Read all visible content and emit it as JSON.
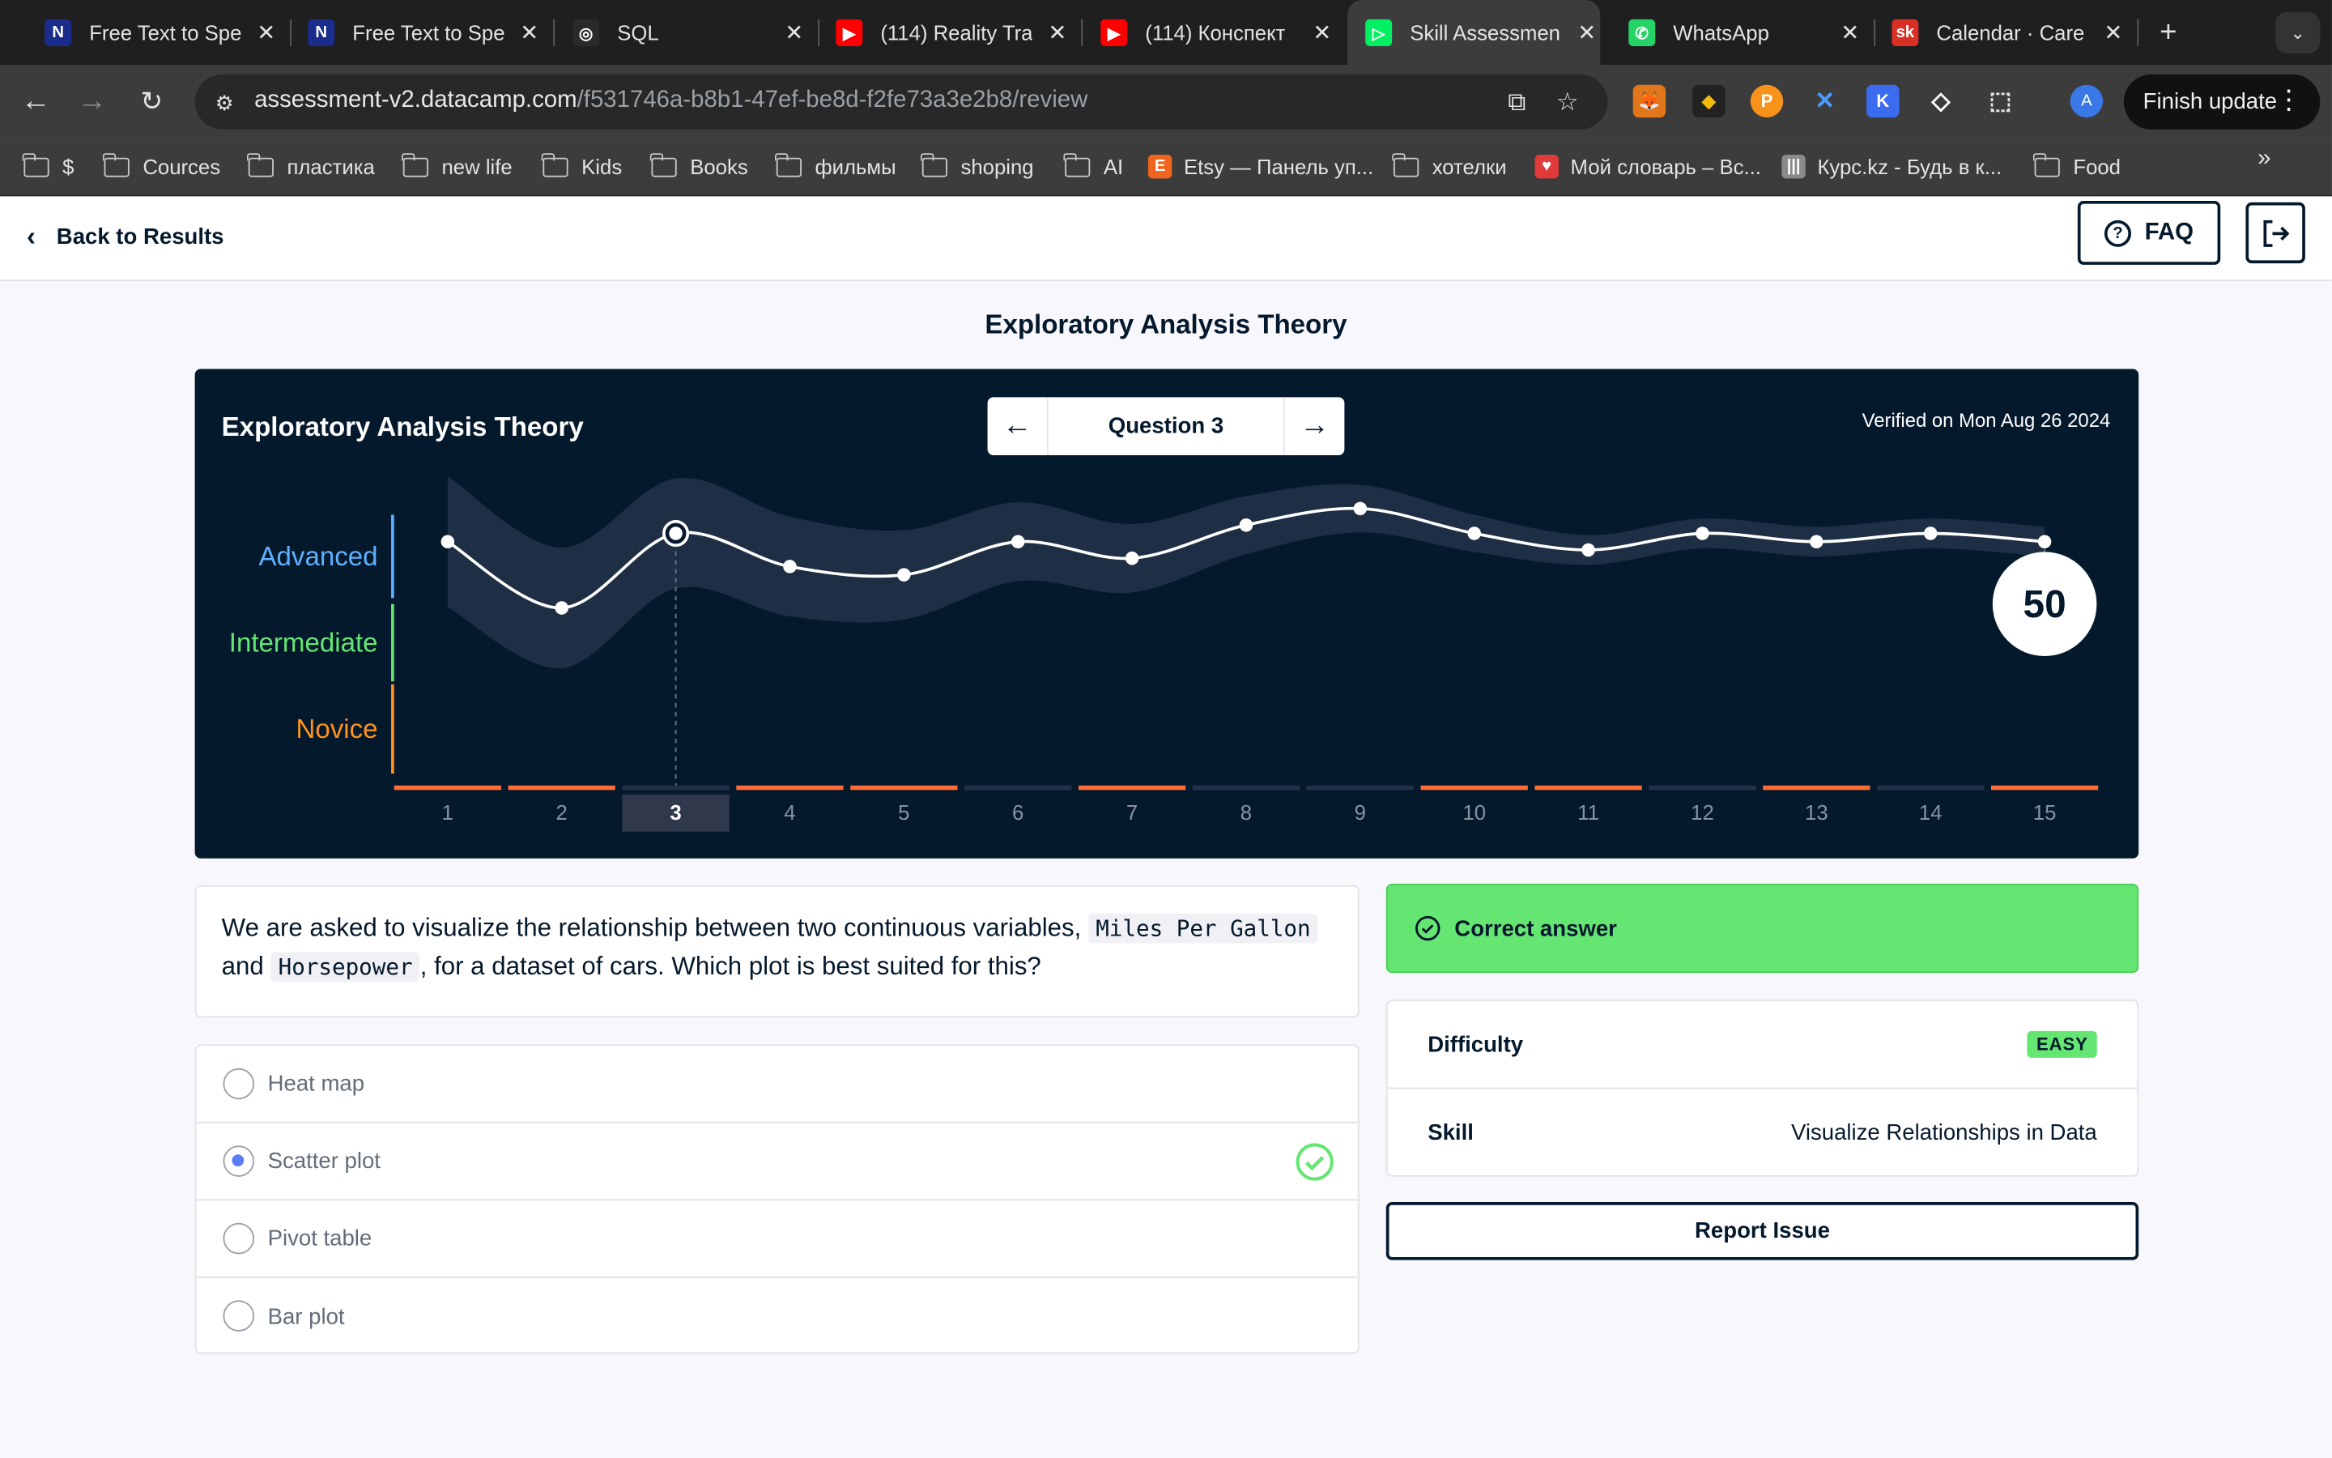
{
  "browser": {
    "tabs": [
      {
        "title": "Free Text to Spe",
        "icon": "N",
        "icon_color": "#1a2c8c"
      },
      {
        "title": "Free Text to Spe",
        "icon": "N",
        "icon_color": "#1a2c8c"
      },
      {
        "title": "SQL",
        "icon": "◎",
        "icon_color": "#2a2a2a"
      },
      {
        "title": "(114) Reality Tra",
        "icon": "▶",
        "icon_color": "#ff0000"
      },
      {
        "title": "(114) Конспект",
        "icon": "▶",
        "icon_color": "#ff0000"
      },
      {
        "title": "Skill Assessmen",
        "icon": "▷",
        "icon_color": "#03ef62"
      },
      {
        "title": "WhatsApp",
        "icon": "✆",
        "icon_color": "#25d366"
      },
      {
        "title": "Calendar · Care",
        "icon": "sk",
        "icon_color": "#d93025"
      }
    ],
    "url_host": "assessment-v2.datacamp.com",
    "url_path": "/f531746a-b8b1-47ef-be8d-f2fe73a3e2b8/review",
    "finish_update": "Finish update",
    "profile_initial": "A",
    "bookmarks": [
      {
        "label": "$",
        "type": "folder"
      },
      {
        "label": "Cources",
        "type": "folder"
      },
      {
        "label": "пластика",
        "type": "folder"
      },
      {
        "label": "new life",
        "type": "folder"
      },
      {
        "label": "Kids",
        "type": "folder"
      },
      {
        "label": "Books",
        "type": "folder"
      },
      {
        "label": "фильмы",
        "type": "folder"
      },
      {
        "label": "shoping",
        "type": "folder"
      },
      {
        "label": "AI",
        "type": "folder"
      },
      {
        "label": "Etsy — Панель уп...",
        "type": "site",
        "icon": "E",
        "color": "#f1641e"
      },
      {
        "label": "хотелки",
        "type": "folder"
      },
      {
        "label": "Мой словарь – Вс...",
        "type": "site",
        "icon": "♥",
        "color": "#e03a3a"
      },
      {
        "label": "Курс.kz - Будь в к...",
        "type": "site",
        "icon": "|||",
        "color": "#8a8a8a"
      },
      {
        "label": "Food",
        "type": "folder"
      }
    ]
  },
  "page": {
    "back_label": "Back to Results",
    "faq_label": "FAQ",
    "title": "Exploratory Analysis Theory",
    "card_title": "Exploratory Analysis Theory",
    "question_label": "Question 3",
    "verified": "Verified on Mon Aug 26 2024",
    "question_text_1": "We are asked to visualize the relationship between two continuous variables,",
    "code_1": "Miles Per Gallon",
    "question_text_2": "and",
    "code_2": "Horsepower",
    "question_text_3": ", for a dataset of cars. Which plot is best suited for this?",
    "options": [
      {
        "label": "Heat map",
        "selected": false,
        "correct": false
      },
      {
        "label": "Scatter plot",
        "selected": true,
        "correct": true
      },
      {
        "label": "Pivot table",
        "selected": false,
        "correct": false
      },
      {
        "label": "Bar plot",
        "selected": false,
        "correct": false
      }
    ],
    "correct_label": "Correct answer",
    "difficulty_label": "Difficulty",
    "difficulty_value": "EASY",
    "skill_label": "Skill",
    "skill_value": "Visualize Relationships in Data",
    "report_label": "Report Issue"
  },
  "chart_data": {
    "type": "line",
    "levels": [
      {
        "name": "Advanced",
        "color": "#5eb1ff"
      },
      {
        "name": "Intermediate",
        "color": "#65e672"
      },
      {
        "name": "Novice",
        "color": "#ff931e"
      }
    ],
    "x": [
      1,
      2,
      3,
      4,
      5,
      6,
      7,
      8,
      9,
      10,
      11,
      12,
      13,
      14,
      15
    ],
    "values": [
      28,
      20,
      29,
      25,
      24,
      28,
      26,
      30,
      32,
      29,
      27,
      29,
      28,
      29,
      28
    ],
    "ylim": [
      0,
      100
    ],
    "current_question": 3,
    "final_score": 50,
    "bar_status": [
      "orange",
      "orange",
      "dark",
      "orange",
      "orange",
      "dark",
      "orange",
      "dark",
      "dark",
      "orange",
      "orange",
      "dark",
      "orange",
      "dark",
      "orange"
    ],
    "status_colors": {
      "orange": "#ff6c35",
      "dark": "#213147"
    }
  }
}
